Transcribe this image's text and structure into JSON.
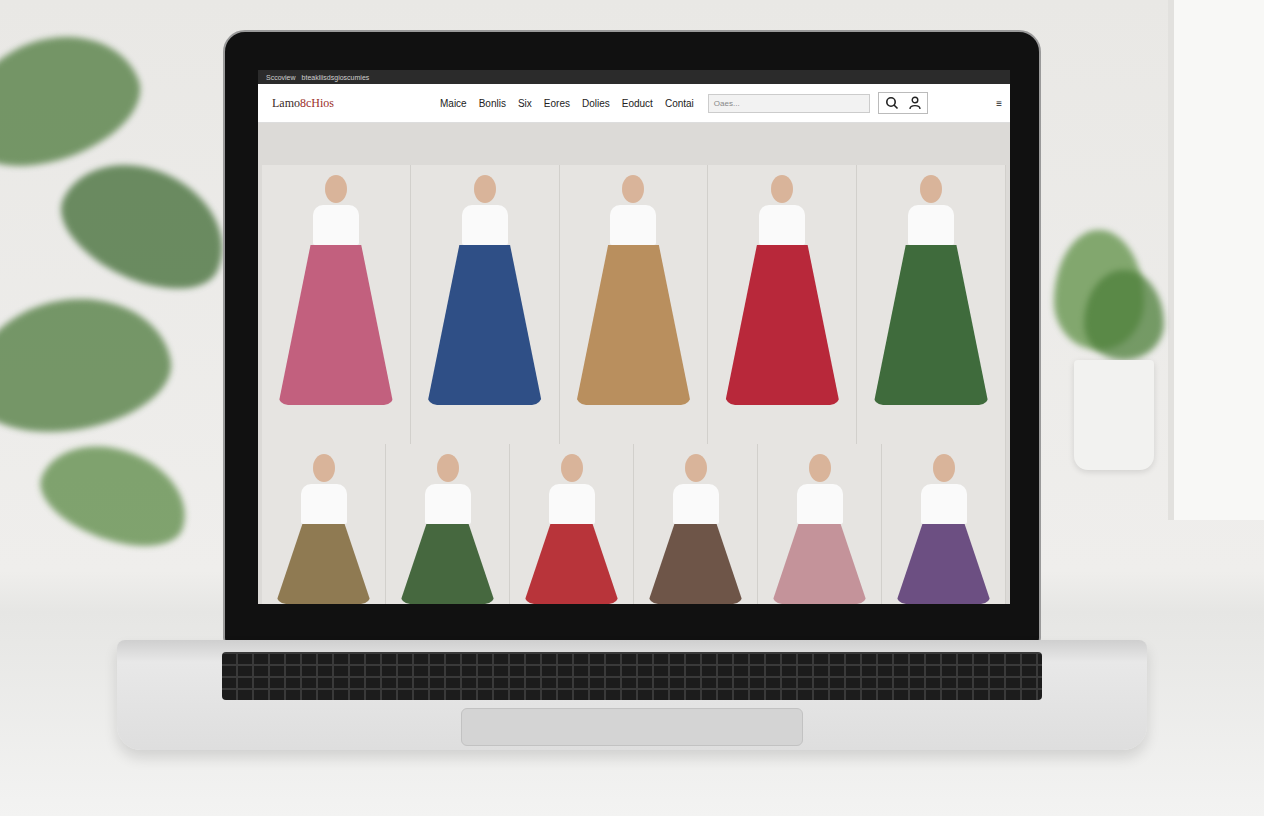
{
  "browser": {
    "tab": "Sccoview",
    "address": "bteakliisdsgioscumies"
  },
  "site": {
    "logo": {
      "first": "Lamo",
      "second": "8cHios"
    },
    "nav": [
      "Maice",
      "Bonlis",
      "Six",
      "Eores",
      "Dolies",
      "Eoduct",
      "Contai"
    ],
    "search": {
      "placeholder": "Oaes..."
    },
    "menu": "≡"
  },
  "products": {
    "top_row": [
      {
        "color": "#c2607e"
      },
      {
        "color": "#2f4f86"
      },
      {
        "color": "#b98f5e"
      },
      {
        "color": "#b8283a"
      },
      {
        "color": "#3f6b3c"
      }
    ],
    "bottom_row": [
      {
        "color": "#8f7a52"
      },
      {
        "color": "#46683f"
      },
      {
        "color": "#b8343a"
      },
      {
        "color": "#6e5548"
      },
      {
        "color": "#c4939a"
      },
      {
        "color": "#6c4f82"
      }
    ]
  }
}
